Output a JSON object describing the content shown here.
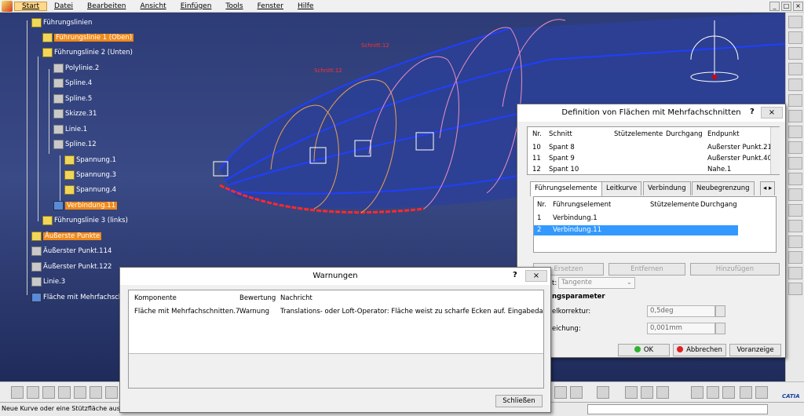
{
  "menu": {
    "items": [
      "Start",
      "Datei",
      "Bearbeiten",
      "Ansicht",
      "Einfügen",
      "Tools",
      "Fenster",
      "Hilfe"
    ],
    "window_controls": [
      "_",
      "□",
      "×"
    ]
  },
  "tree": {
    "nodes": [
      {
        "label": "Führungslinien",
        "highlighted": false
      },
      {
        "label": "Führungslinie 1 (Oben)",
        "highlighted": true
      },
      {
        "label": "Führungslinie 2 (Unten)",
        "highlighted": false
      },
      {
        "label": "Polylinie.2",
        "highlighted": false
      },
      {
        "label": "Spline.4",
        "highlighted": false
      },
      {
        "label": "Spline.5",
        "highlighted": false
      },
      {
        "label": "Skizze.31",
        "highlighted": false
      },
      {
        "label": "Linie.1",
        "highlighted": false
      },
      {
        "label": "Spline.12",
        "highlighted": false
      },
      {
        "label": "Spannung.1",
        "highlighted": false
      },
      {
        "label": "Spannung.3",
        "highlighted": false
      },
      {
        "label": "Spannung.4",
        "highlighted": false
      },
      {
        "label": "Verbindung.11",
        "highlighted": true
      },
      {
        "label": "Führungslinie 3 (links)",
        "highlighted": false
      },
      {
        "label": "Äußerste Punkte",
        "highlighted": true
      },
      {
        "label": "Äußerster Punkt.114",
        "highlighted": false
      },
      {
        "label": "Äußerster Punkt.122",
        "highlighted": false
      },
      {
        "label": "Linie.3",
        "highlighted": false
      },
      {
        "label": "Fläche mit Mehrfachschn",
        "highlighted": false
      }
    ]
  },
  "viewport_labels": {
    "label1": "Schnitt.12",
    "label2": "Schnitt.12"
  },
  "loft_dialog": {
    "title": "Definition von Flächen mit Mehrfachschnitten",
    "help": "?",
    "close": "×",
    "sections_headers": [
      "Nr.",
      "Schnitt",
      "Stützelemente",
      "Durchgang",
      "Endpunkt"
    ],
    "sections_rows": [
      [
        "10",
        "Spant 8",
        "",
        "",
        "Äußerster Punkt.21"
      ],
      [
        "11",
        "Spant 9",
        "",
        "",
        "Äußerster Punkt.40"
      ],
      [
        "12",
        "Spant 10",
        "",
        "",
        "Nahe.1"
      ]
    ],
    "tabs": [
      "Führungselemente",
      "Leitkurve",
      "Verbindung",
      "Neubegrenzung"
    ],
    "guides_headers": [
      "Nr.",
      "Führungselement",
      "Stützelemente",
      "Durchgang"
    ],
    "guides_rows": [
      [
        "1",
        "Verbindung.1",
        "",
        ""
      ],
      [
        "2",
        "Verbindung.11",
        "",
        ""
      ]
    ],
    "selected_guide_index": 1,
    "action_buttons": [
      "Ersetzen",
      "Entfernen",
      "Hinzufügen"
    ],
    "tangent_label": "t:",
    "tangent_value": "Tangente",
    "params_heading": "ngsparameter",
    "param1_label": "elkorrektur:",
    "param1_value": "0,5deg",
    "param2_label": "eichung:",
    "param2_value": "0,001mm",
    "ok_label": "OK",
    "cancel_label": "Abbrechen",
    "preview_label": "Voranzeige"
  },
  "warn_dialog": {
    "title": "Warnungen",
    "help": "?",
    "close": "×",
    "headers": [
      "Komponente",
      "Bewertung",
      "Nachricht"
    ],
    "rows": [
      [
        "Fläche mit Mehrfachschnitten.7",
        "Warnung",
        "Translations- oder Loft-Operator: Fläche weist zu scharfe Ecken auf. Eingabedaten..."
      ]
    ],
    "close_button": "Schließen"
  },
  "status": {
    "text": "Neue Kurve oder eine Stützfläche ausw"
  },
  "branding": {
    "logo": "CATIA"
  },
  "colors": {
    "highlight": "#f08a1a",
    "selection": "#3399ff",
    "curve": "#1f3fff"
  }
}
